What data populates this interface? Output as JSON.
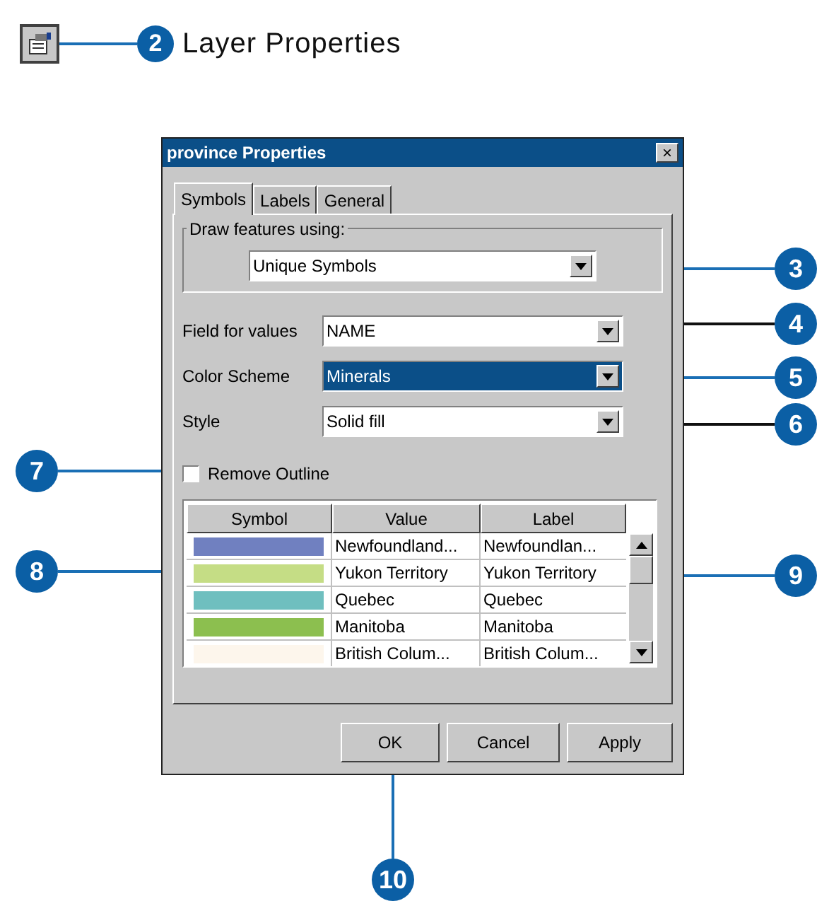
{
  "header": {
    "callout": "2",
    "title": "Layer Properties"
  },
  "dialog": {
    "title": "province Properties",
    "close": "×",
    "tabs": [
      {
        "label": "Symbols",
        "selected": true
      },
      {
        "label": "Labels",
        "selected": false
      },
      {
        "label": "General",
        "selected": false
      }
    ],
    "group": {
      "legend": "Draw features using:",
      "value": "Unique Symbols"
    },
    "fields": [
      {
        "label": "Field for values",
        "value": "NAME",
        "highlighted": false
      },
      {
        "label": "Color Scheme",
        "value": "Minerals",
        "highlighted": true
      },
      {
        "label": "Style",
        "value": "Solid fill",
        "highlighted": false
      }
    ],
    "remove_outline": {
      "label": "Remove Outline",
      "checked": false
    },
    "table": {
      "columns": [
        "Symbol",
        "Value",
        "Label"
      ],
      "rows": [
        {
          "color": "#7080c0",
          "value": "Newfoundland...",
          "label": "Newfoundlan..."
        },
        {
          "color": "#c5dd85",
          "value": "Yukon Territory",
          "label": "Yukon Territory"
        },
        {
          "color": "#6fbfbf",
          "value": "Quebec",
          "label": "Quebec"
        },
        {
          "color": "#8cbf4f",
          "value": "Manitoba",
          "label": "Manitoba"
        },
        {
          "color": "#fdf6ec",
          "value": "British Colum...",
          "label": "British Colum..."
        }
      ]
    },
    "buttons": [
      "OK",
      "Cancel",
      "Apply"
    ]
  },
  "callouts": [
    {
      "number": "3",
      "color": "#1a6fb5"
    },
    {
      "number": "4",
      "color": "#111111"
    },
    {
      "number": "5",
      "color": "#1a6fb5"
    },
    {
      "number": "6",
      "color": "#111111"
    },
    {
      "number": "7",
      "color": "#1a6fb5"
    },
    {
      "number": "8",
      "color": "#1a6fb5"
    },
    {
      "number": "9",
      "color": "#1a6fb5"
    },
    {
      "number": "10",
      "color": "#1a6fb5"
    }
  ]
}
